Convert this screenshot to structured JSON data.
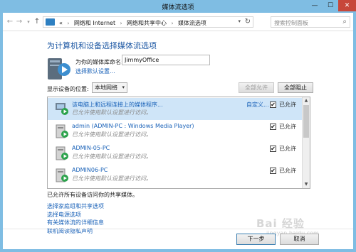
{
  "window": {
    "title": "媒体流选项",
    "min_glyph": "—",
    "max_glyph": "☐",
    "close_glyph": "✕"
  },
  "nav": {
    "back": "←",
    "forward": "→",
    "dropdown": "▾",
    "up": "↑"
  },
  "address": {
    "prefix": "«",
    "crumbs": [
      "网络和 Internet",
      "网络和共享中心",
      "媒体流选项"
    ],
    "sep": "›",
    "dropdown": "▾",
    "refresh": "↻"
  },
  "search": {
    "placeholder": "搜索控制面板",
    "icon": "search-icon",
    "glyph": "⌕"
  },
  "heading": "为计算机和设备选择媒体流选项",
  "library": {
    "name_label": "为你的媒体库命名:",
    "name_value": "JimmyOffice",
    "choose_default_link": "选择默认设置..."
  },
  "show_devices": {
    "label": "显示设备的位置:",
    "selected": "本地网络",
    "arrow": "▾"
  },
  "buttons": {
    "allow_all": "全部允许",
    "block_all": "全部阻止",
    "next": "下一步",
    "cancel": "取消"
  },
  "devices": [
    {
      "name": "该电脑上和远程连接上的媒体程序...",
      "sub": "已允许使用默认设置进行访问。",
      "custom": "自定义...",
      "checked": "✔",
      "allowed": "已允许",
      "selected": true
    },
    {
      "name": "admin (ADMIN-PC : Windows Media Player)",
      "sub": "已允许使用默认设置进行访问。",
      "custom": "",
      "checked": "✔",
      "allowed": "已允许",
      "selected": false
    },
    {
      "name": "ADMIN-05-PC",
      "sub": "已允许使用默认设置进行访问。",
      "custom": "",
      "checked": "✔",
      "allowed": "已允许",
      "selected": false
    },
    {
      "name": "ADMIN06-PC",
      "sub": "已允许使用默认设置进行访问。",
      "custom": "",
      "checked": "✔",
      "allowed": "已允许",
      "selected": false
    }
  ],
  "scrollbar": {
    "up": "▲",
    "down": "▼"
  },
  "status": "已允许所有设备访问你的共享媒体。",
  "links": [
    "选择家庭组和共享选项",
    "选择电源选项",
    "有关媒体流的详细信息",
    "联机阅读隐私声明"
  ],
  "watermark": {
    "text": "Bai 经验",
    "sub": "jingyan.baidu.com"
  },
  "colors": {
    "frame": "#7fbde3",
    "link": "#1a62b8",
    "heading": "#1c57a3",
    "close": "#c7473a",
    "selected_row": "#cfe5f8"
  }
}
